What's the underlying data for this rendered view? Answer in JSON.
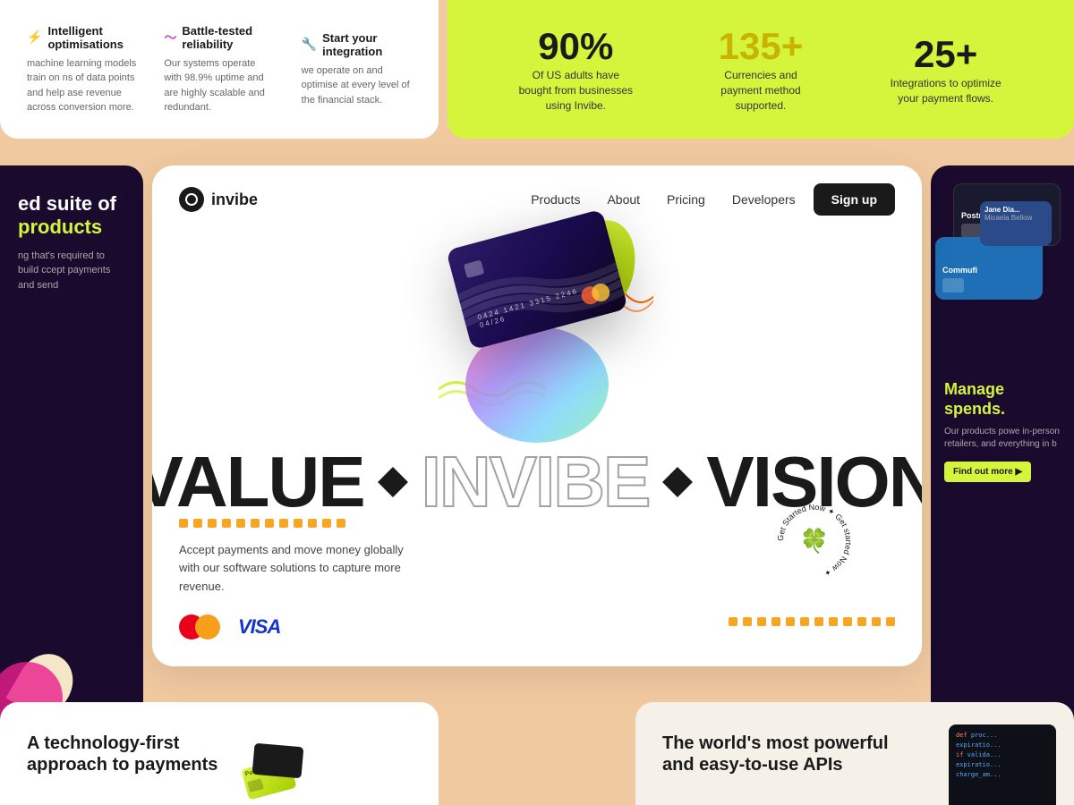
{
  "brand": {
    "name": "invibe",
    "logo_alt": "invibe logo"
  },
  "nav": {
    "links": [
      {
        "label": "Products",
        "id": "products"
      },
      {
        "label": "About",
        "id": "about"
      },
      {
        "label": "Pricing",
        "id": "pricing"
      },
      {
        "label": "Developers",
        "id": "developers"
      }
    ],
    "cta": "Sign up"
  },
  "top_strip": {
    "stats": [
      {
        "value": "90%",
        "desc": "Of US adults have bought from businesses using Invibe.",
        "color": "dark"
      },
      {
        "value": "135+",
        "desc": "Currencies and payment method supported.",
        "color": "yellow"
      },
      {
        "value": "25+",
        "desc": "Integrations to optimize your payment flows.",
        "color": "dark"
      }
    ]
  },
  "top_left_features": [
    {
      "title": "Intelligent optimisations",
      "icon": "⚡",
      "icon_color": "pink",
      "desc": "machine learning models train on ns of data points and help ase revenue across conversion more."
    },
    {
      "title": "Battle-tested reliability",
      "icon": "~",
      "icon_color": "pink",
      "desc": "Our systems operate with 98.9% uptime and are highly scalable and redundant."
    },
    {
      "title": "Start your integration",
      "icon": "🔧",
      "icon_color": "green",
      "desc": "we operate on and optimise at every level of the financial stack."
    }
  ],
  "hero": {
    "title_left": "VALUE",
    "title_right": "VISION",
    "title_center": "INVIBE",
    "desc": "Accept payments and move money globally with our software solutions to capture more revenue.",
    "badge_text": "Get Started Now Get started Now",
    "clover": "🍀"
  },
  "payment_brands": {
    "mastercard": "Mastercard",
    "visa": "VISA"
  },
  "left_panel": {
    "heading_line1": "ed suite of",
    "heading_line2": "products",
    "highlight": "products",
    "desc": "ng that's required to build ccept payments and send"
  },
  "right_panel": {
    "manage_text": "Manage\nspends.",
    "desc": "Our products powe in-person retailers, and everything in b",
    "find_out": "Find out more ▶"
  },
  "bottom_left": {
    "heading": "A technology-first\napproach to payments"
  },
  "bottom_right": {
    "heading": "The world's most powerful\nand easy-to-use APIs"
  },
  "card": {
    "number": "0424  1421  3315  2246",
    "date": "04/26"
  },
  "colors": {
    "accent_green": "#d4f53c",
    "dark_bg": "#1a0a2e",
    "peach_bg": "#f0c9a0",
    "white": "#ffffff"
  }
}
